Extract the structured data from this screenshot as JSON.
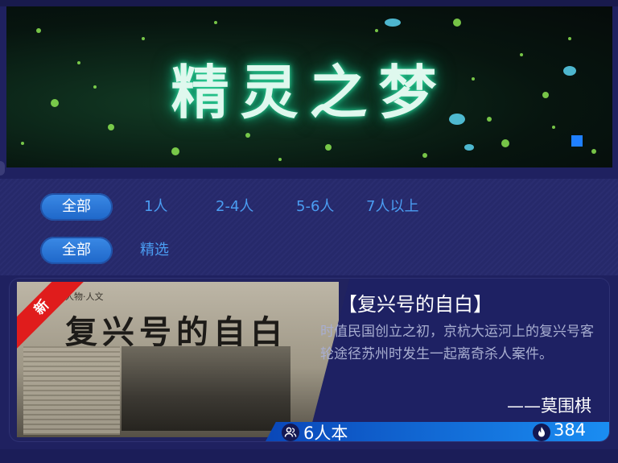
{
  "banner": {
    "title": "精灵之梦",
    "accent_color": "#1f7fff"
  },
  "filters": {
    "players": {
      "selected": "全部",
      "options": [
        "1人",
        "2-4人",
        "5-6人",
        "7人以上"
      ]
    },
    "category": {
      "selected": "全部",
      "options": [
        "精选"
      ]
    }
  },
  "card": {
    "badge": "新",
    "cover": {
      "paper_header": "人物·人文",
      "headline": "复兴号的自白"
    },
    "title": "【复兴号的自白】",
    "description": "时值民国创立之初，京杭大运河上的复兴号客轮途径苏州时发生一起离奇杀人案件。",
    "author": "——莫围棋",
    "players": "6人本",
    "heat": "384",
    "icons": {
      "players": "people-icon",
      "heat": "fire-icon"
    }
  }
}
